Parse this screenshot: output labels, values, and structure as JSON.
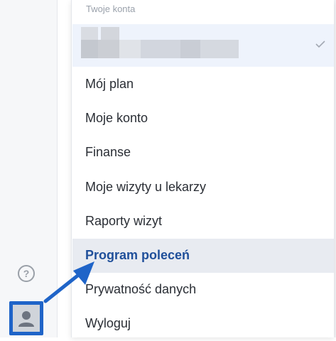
{
  "sidebar": {
    "help_icon": "question-circle-icon",
    "avatar_icon": "user-avatar-icon",
    "accent_color": "#1f64c8"
  },
  "menu": {
    "section_title": "Twoje konta",
    "selected_account_icon": "check-icon",
    "items": [
      {
        "label": "Mój plan"
      },
      {
        "label": "Moje konto"
      },
      {
        "label": "Finanse"
      },
      {
        "label": "Moje wizyty u lekarzy"
      },
      {
        "label": "Raporty wizyt"
      },
      {
        "label": "Program poleceń"
      },
      {
        "label": "Prywatność danych"
      },
      {
        "label": "Wyloguj"
      }
    ],
    "highlighted_item": "Program poleceń",
    "highlight_text_color": "#1f4f9a"
  },
  "annotation": {
    "arrow_color": "#1f64c8"
  }
}
